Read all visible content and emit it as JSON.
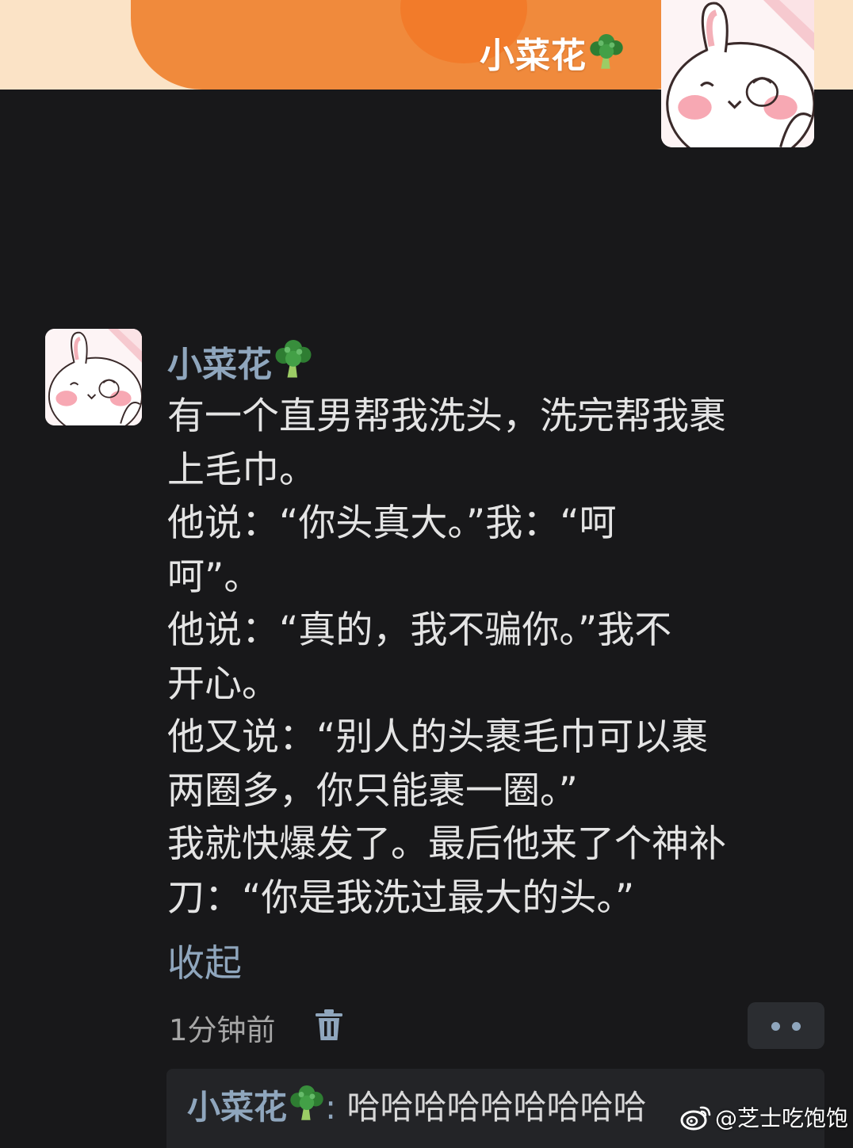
{
  "header": {
    "title": "小菜花"
  },
  "comment": {
    "author": "小菜花",
    "lines": [
      "有一个直男帮我洗头，洗完帮我裹",
      "上毛巾。",
      "他说：“你头真大。”我：“呵",
      "呵”。",
      "他说：“真的，我不骗你。”我不",
      "开心。",
      "他又说：“别人的头裹毛巾可以裹",
      "两圈多，你只能裹一圈。”",
      "我就快爆发了。最后他来了个神补",
      "刀：“你是我洗过最大的头。”"
    ],
    "collapse_label": "收起",
    "timestamp": "1分钟前"
  },
  "reply": {
    "author": "小菜花",
    "colon": ":",
    "text": "哈哈哈哈哈哈哈哈哈"
  },
  "watermark": {
    "text": "@芝士吃饱饱"
  },
  "icons": {
    "author_emoji": "broccoli-icon",
    "delete": "trash-icon",
    "more": "more-dots-icon",
    "watermark_logo": "weibo-logo-icon"
  },
  "colors": {
    "background": "#18181a",
    "banner_orange": "#f08a3c",
    "banner_cream": "#fbe3c6",
    "username_blue": "#8fa6bd",
    "body_text": "#e4e4e4",
    "muted_text": "#a6a6a6"
  }
}
